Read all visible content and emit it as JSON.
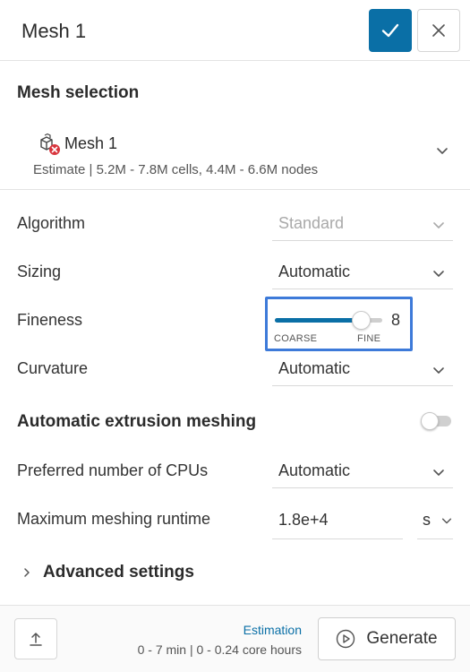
{
  "header": {
    "title": "Mesh 1",
    "confirm_icon": "checkmark-icon",
    "close_icon": "close-icon"
  },
  "mesh_selection": {
    "title": "Mesh selection",
    "item_icon": "geometry-error-icon",
    "item_name": "Mesh 1",
    "estimate": "Estimate | 5.2M - 7.8M cells, 4.4M - 6.6M nodes"
  },
  "settings": {
    "algorithm": {
      "label": "Algorithm",
      "value": "Standard",
      "disabled": true
    },
    "sizing": {
      "label": "Sizing",
      "value": "Automatic"
    },
    "fineness": {
      "label": "Fineness",
      "value": "8",
      "level_fraction": 0.8,
      "min_label": "COARSE",
      "max_label": "FINE"
    },
    "curvature": {
      "label": "Curvature",
      "value": "Automatic"
    },
    "auto_extrusion": {
      "label": "Automatic extrusion meshing",
      "enabled": false
    },
    "cpus": {
      "label": "Preferred number of CPUs",
      "value": "Automatic"
    },
    "runtime": {
      "label": "Maximum meshing runtime",
      "value": "1.8e+4",
      "unit": "s"
    }
  },
  "advanced": {
    "label": "Advanced settings"
  },
  "footer": {
    "export_icon": "upload-icon",
    "estimation_title": "Estimation",
    "estimation_detail": "0 - 7 min | 0 - 0.24 core hours",
    "generate_label": "Generate",
    "generate_icon": "play-circle-icon"
  },
  "colors": {
    "accent": "#0a6fa6",
    "highlight_border": "#3d7ad9",
    "error": "#d9363e"
  }
}
